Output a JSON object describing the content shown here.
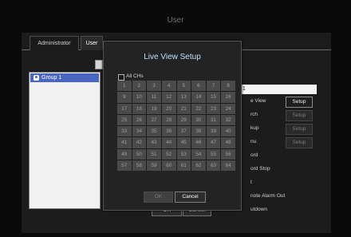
{
  "page": {
    "title": "User"
  },
  "tabs": [
    {
      "label": "Administrator"
    },
    {
      "label": "User"
    }
  ],
  "tree": {
    "group": "Group 1"
  },
  "right_panel": {
    "group_name": "p 1",
    "rows": [
      {
        "label": "e View",
        "button": "Setup",
        "active": true
      },
      {
        "label": "rch",
        "button": "Setup",
        "active": false
      },
      {
        "label": "kup",
        "button": "Setup",
        "active": false
      },
      {
        "label": "nu",
        "button": "Setup",
        "active": false
      },
      {
        "label": "ord"
      },
      {
        "label": "ord Stop"
      },
      {
        "label": "t"
      },
      {
        "label": "note Alarm Out"
      },
      {
        "label": "utdown"
      }
    ]
  },
  "modal": {
    "title": "Live View Setup",
    "all_checkbox": "All CHs",
    "channels": [
      "1",
      "2",
      "3",
      "4",
      "5",
      "6",
      "7",
      "8",
      "9",
      "10",
      "11",
      "12",
      "13",
      "14",
      "15",
      "16",
      "17",
      "18",
      "19",
      "20",
      "21",
      "22",
      "23",
      "24",
      "25",
      "26",
      "27",
      "28",
      "29",
      "30",
      "31",
      "32",
      "33",
      "34",
      "35",
      "36",
      "37",
      "38",
      "39",
      "40",
      "41",
      "42",
      "43",
      "44",
      "45",
      "46",
      "47",
      "48",
      "49",
      "50",
      "51",
      "52",
      "53",
      "54",
      "55",
      "56",
      "57",
      "58",
      "59",
      "60",
      "61",
      "62",
      "63",
      "64"
    ],
    "ok": "OK",
    "cancel": "Cancel"
  },
  "bottom": {
    "ok": "OK",
    "cancel": "Cancel"
  },
  "colors": {
    "accent_blue": "#4a66c4",
    "modal_title": "#bfe0ff"
  }
}
